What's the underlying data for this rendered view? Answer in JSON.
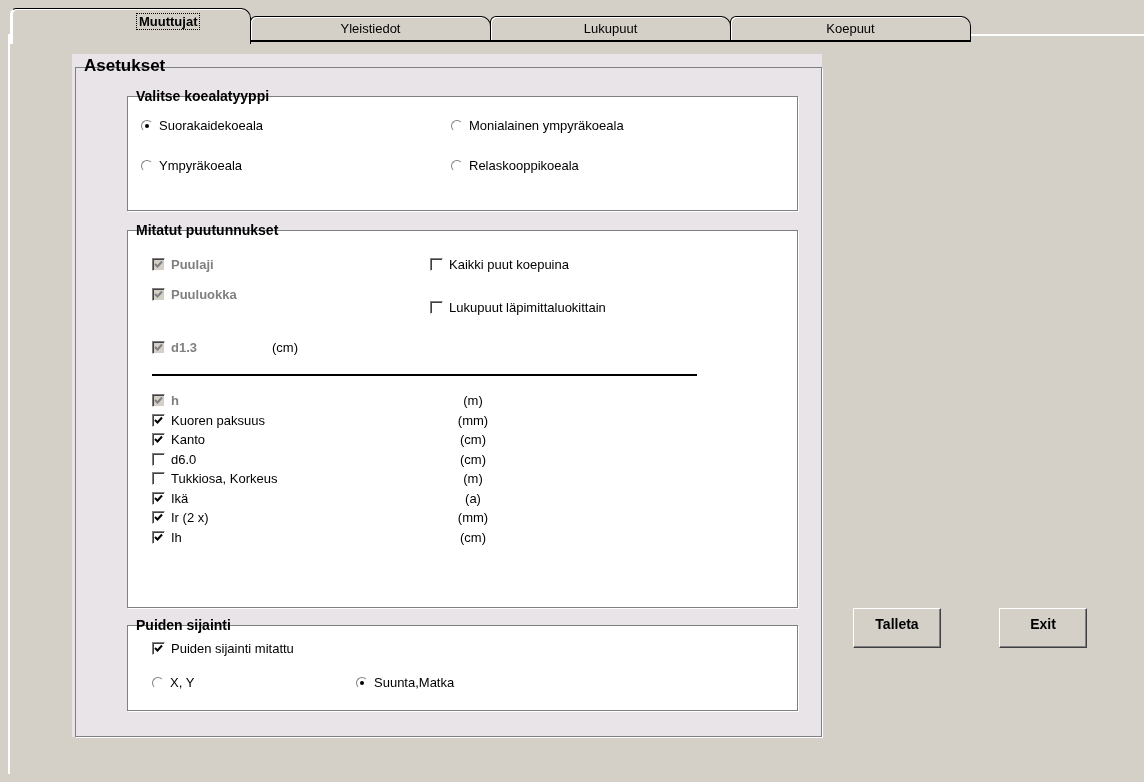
{
  "tabs": [
    {
      "label": "Muuttujat",
      "selected": true
    },
    {
      "label": "Yleistiedot",
      "selected": false
    },
    {
      "label": "Lukupuut",
      "selected": false
    },
    {
      "label": "Koepuut",
      "selected": false
    }
  ],
  "settings": {
    "title": "Asetukset",
    "plot_type": {
      "title": "Valitse koealatyyppi",
      "options": [
        {
          "label": "Suorakaidekoeala",
          "selected": true
        },
        {
          "label": "Monialainen ympyräkoeala",
          "selected": false
        },
        {
          "label": "Ympyräkoeala",
          "selected": false
        },
        {
          "label": "Relaskooppikoeala",
          "selected": false
        }
      ]
    },
    "measured": {
      "title": "Mitatut puutunnukset",
      "main": [
        {
          "label": "Puulaji",
          "checked": true,
          "disabled": true
        },
        {
          "label": "Puuluokka",
          "checked": true,
          "disabled": true
        },
        {
          "label": "d1.3",
          "unit": "(cm)",
          "checked": true,
          "disabled": true
        }
      ],
      "options": [
        {
          "label": "Kaikki puut koepuina",
          "checked": false
        },
        {
          "label": "Lukupuut läpimittaluokittain",
          "checked": false
        }
      ],
      "attributes": [
        {
          "label": "h",
          "unit": "(m)",
          "checked": true,
          "disabled": true
        },
        {
          "label": "Kuoren paksuus",
          "unit": "(mm)",
          "checked": true,
          "disabled": false
        },
        {
          "label": "Kanto",
          "unit": "(cm)",
          "checked": true,
          "disabled": false
        },
        {
          "label": "d6.0",
          "unit": "(cm)",
          "checked": false,
          "disabled": false
        },
        {
          "label": "Tukkiosa, Korkeus",
          "unit": "(m)",
          "checked": false,
          "disabled": false
        },
        {
          "label": "Ikä",
          "unit": "(a)",
          "checked": true,
          "disabled": false
        },
        {
          "label": "Ir (2 x)",
          "unit": "(mm)",
          "checked": true,
          "disabled": false
        },
        {
          "label": "Ih",
          "unit": "(cm)",
          "checked": true,
          "disabled": false
        }
      ]
    },
    "location": {
      "title": "Puiden sijainti",
      "measured": {
        "label": "Puiden sijainti mitattu",
        "checked": true
      },
      "options": [
        {
          "label": "X, Y",
          "selected": false
        },
        {
          "label": "Suunta,Matka",
          "selected": true
        }
      ]
    }
  },
  "buttons": [
    {
      "label": "Talleta"
    },
    {
      "label": "Exit"
    }
  ]
}
